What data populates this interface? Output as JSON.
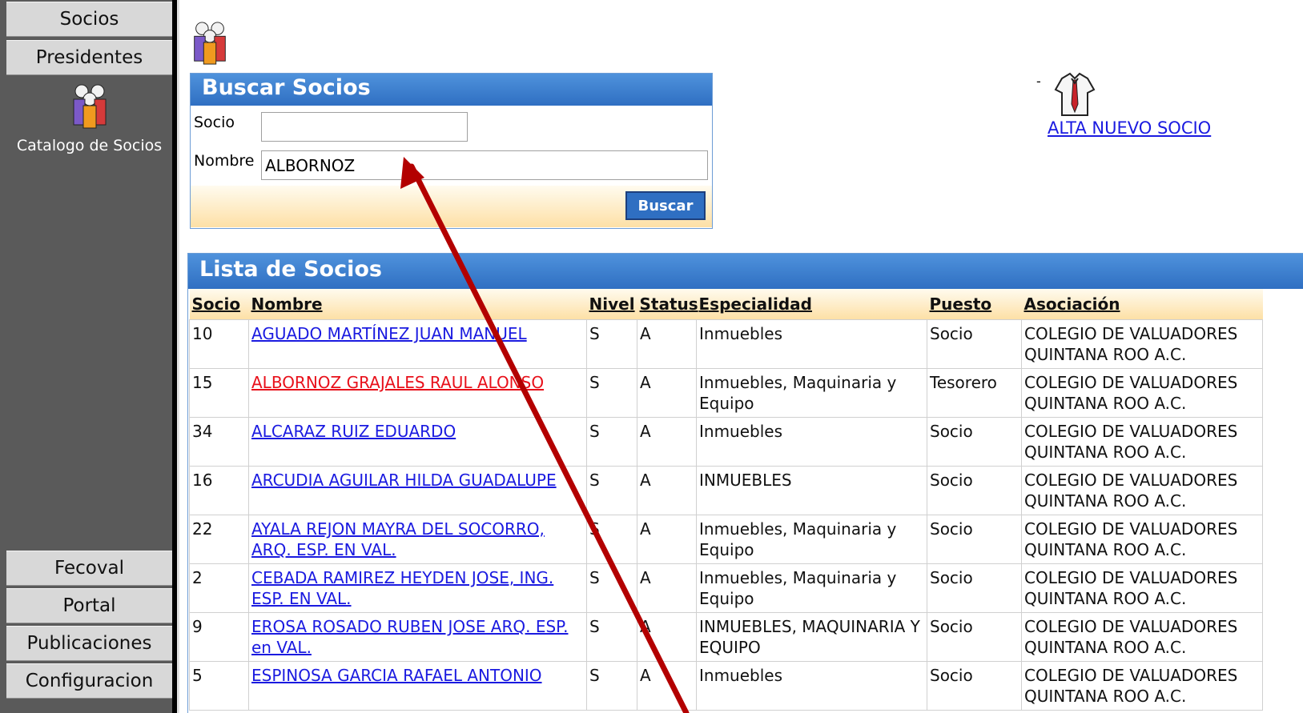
{
  "sidebar": {
    "top_items": [
      "Socios",
      "Presidentes"
    ],
    "active_label": "Catalogo de Socios",
    "bottom_items": [
      "Fecoval",
      "Portal",
      "Publicaciones",
      "Configuracion"
    ]
  },
  "search": {
    "title": "Buscar Socios",
    "socio_label": "Socio",
    "socio_value": "",
    "nombre_label": "Nombre",
    "nombre_value": "ALBORNOZ",
    "button": "Buscar"
  },
  "alta": {
    "dash": "-",
    "link": "ALTA NUEVO SOCIO"
  },
  "list": {
    "title": "Lista de Socios",
    "headers": [
      "Socio",
      "Nombre",
      "Nivel",
      "Status",
      "Especialidad",
      "Puesto",
      "Asociación"
    ],
    "rows": [
      {
        "socio": "10",
        "nombre": "AGUADO MARTÍNEZ JUAN MANUEL",
        "nivel": "S",
        "status": "A",
        "especialidad": "Inmuebles",
        "puesto": "Socio",
        "asociacion": "COLEGIO DE VALUADORES QUINTANA ROO A.C."
      },
      {
        "socio": "15",
        "nombre": "ALBORNOZ GRAJALES RAUL ALONSO",
        "nivel": "S",
        "status": "A",
        "especialidad": "Inmuebles, Maquinaria y Equipo",
        "puesto": "Tesorero",
        "asociacion": "COLEGIO DE VALUADORES QUINTANA ROO A.C."
      },
      {
        "socio": "34",
        "nombre": "ALCARAZ RUIZ EDUARDO",
        "nivel": "S",
        "status": "A",
        "especialidad": "Inmuebles",
        "puesto": "Socio",
        "asociacion": "COLEGIO DE VALUADORES QUINTANA ROO A.C."
      },
      {
        "socio": "16",
        "nombre": "ARCUDIA AGUILAR HILDA GUADALUPE",
        "nivel": "S",
        "status": "A",
        "especialidad": "INMUEBLES",
        "puesto": "Socio",
        "asociacion": "COLEGIO DE VALUADORES QUINTANA ROO A.C."
      },
      {
        "socio": "22",
        "nombre": "AYALA REJON MAYRA DEL SOCORRO, ARQ. ESP. EN VAL.",
        "nivel": "S",
        "status": "A",
        "especialidad": "Inmuebles, Maquinaria y Equipo",
        "puesto": "Socio",
        "asociacion": "COLEGIO DE VALUADORES QUINTANA ROO A.C."
      },
      {
        "socio": "2",
        "nombre": "CEBADA RAMIREZ HEYDEN JOSE, ING. ESP. EN VAL.",
        "nivel": "S",
        "status": "A",
        "especialidad": "Inmuebles, Maquinaria y Equipo",
        "puesto": "Socio",
        "asociacion": "COLEGIO DE VALUADORES QUINTANA ROO A.C."
      },
      {
        "socio": "9",
        "nombre": "EROSA ROSADO RUBEN JOSE ARQ. ESP. en VAL.",
        "nivel": "S",
        "status": "A",
        "especialidad": "INMUEBLES, MAQUINARIA Y EQUIPO",
        "puesto": "Socio",
        "asociacion": "COLEGIO DE VALUADORES QUINTANA ROO A.C."
      },
      {
        "socio": "5",
        "nombre": "ESPINOSA GARCIA RAFAEL ANTONIO",
        "nivel": "S",
        "status": "A",
        "especialidad": "Inmuebles",
        "puesto": "Socio",
        "asociacion": "COLEGIO DE VALUADORES QUINTANA ROO A.C."
      }
    ],
    "highlighted_row": 1
  },
  "annotation": {
    "arrow_color": "#b30000"
  }
}
